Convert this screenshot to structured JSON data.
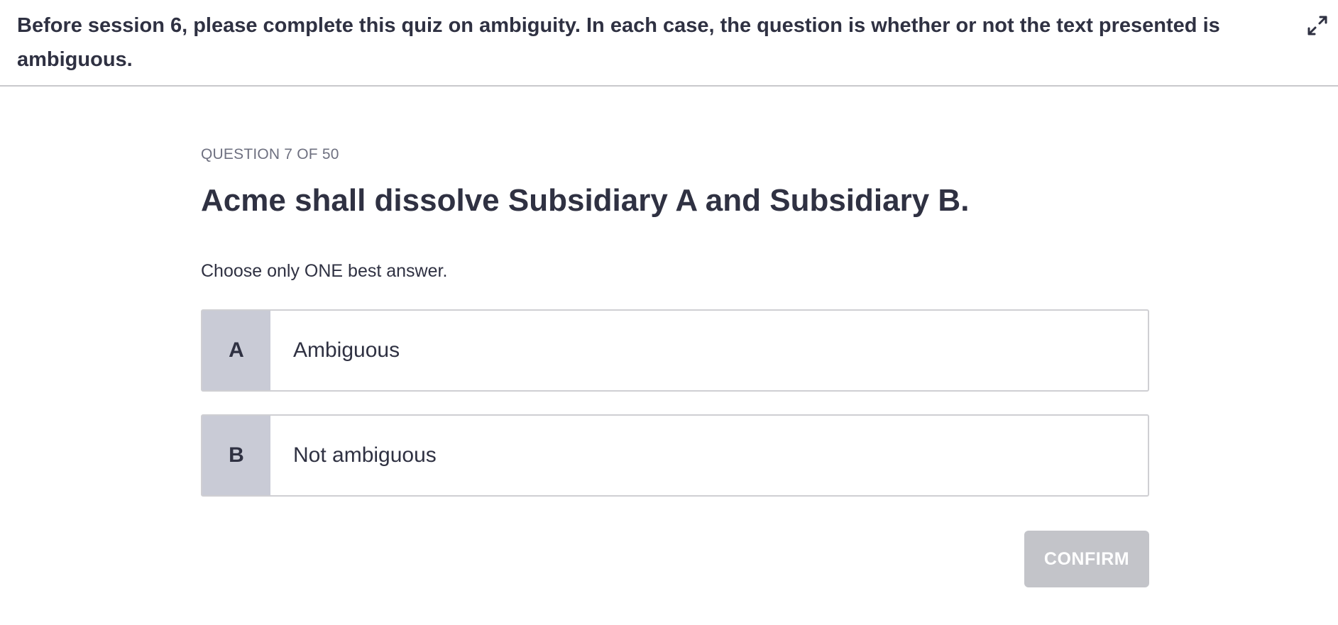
{
  "header": {
    "instructions": "Before session 6, please complete this quiz on ambiguity. In each case, the question is whether or not the text presented is ambiguous.",
    "expand_icon": "expand-icon"
  },
  "question": {
    "counter": "QUESTION 7 OF 50",
    "title": "Acme shall dissolve Subsidiary A and Subsidiary B.",
    "instruction": "Choose only ONE best answer."
  },
  "options": [
    {
      "letter": "A",
      "text": "Ambiguous"
    },
    {
      "letter": "B",
      "text": "Not ambiguous"
    }
  ],
  "actions": {
    "confirm_label": "CONFIRM"
  },
  "colors": {
    "text": "#2f3142",
    "letter_bg": "#c9cbd6",
    "confirm_disabled_bg": "#c3c4c9",
    "border": "#cfcfd3"
  }
}
